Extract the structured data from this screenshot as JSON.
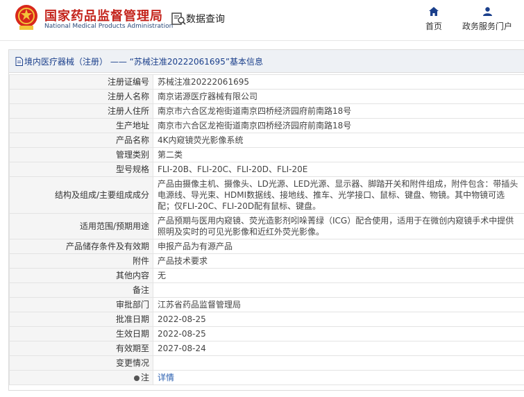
{
  "header": {
    "logo_cn": "国家药品监督管理局",
    "logo_en": "National Medical Products Administration",
    "query_label": "数据查询",
    "nav_home": "首页",
    "nav_portal": "政务服务门户",
    "brand_color": "#c4241c",
    "link_color": "#1a3f8b"
  },
  "panel": {
    "title": "境内医疗器械（注册） ——  “苏械注准20222061695”基本信息"
  },
  "rows": [
    {
      "label": "注册证编号",
      "value": "苏械注准20222061695"
    },
    {
      "label": "注册人名称",
      "value": "南京诺源医疗器械有限公司"
    },
    {
      "label": "注册人住所",
      "value": "南京市六合区龙袍街道南京四桥经济园府前南路18号"
    },
    {
      "label": "生产地址",
      "value": "南京市六合区龙袍街道南京四桥经济园府前南路18号"
    },
    {
      "label": "产品名称",
      "value": "4K内窥镜荧光影像系统"
    },
    {
      "label": "管理类别",
      "value": "第二类"
    },
    {
      "label": "型号规格",
      "value": "FLI-20B、FLI-20C、FLI-20D、FLI-20E"
    },
    {
      "label": "结构及组成/主要组成成分",
      "value": "产品由摄像主机、摄像头、LD光源、LED光源、显示器、脚踏开关和附件组成，附件包含：带插头电源线、导光束、HDMI数据线、接地线、推车、光学接口、鼠标、键盘、物镜。其中物镜可选配；仅FLI-20C、FLI-20D配有鼠标、键盘。"
    },
    {
      "label": "适用范围/预期用途",
      "value": "产品预期与医用内窥镜、荧光造影剂吲哚菁绿（ICG）配合使用，适用于在微创内窥镜手术中提供照明及实时的可见光影像和近红外荧光影像。"
    },
    {
      "label": "产品储存条件及有效期",
      "value": "申报产品为有源产品"
    },
    {
      "label": "附件",
      "value": "产品技术要求"
    },
    {
      "label": "其他内容",
      "value": "无"
    },
    {
      "label": "备注",
      "value": ""
    },
    {
      "label": "审批部门",
      "value": "江苏省药品监督管理局"
    },
    {
      "label": "批准日期",
      "value": "2022-08-25"
    },
    {
      "label": "生效日期",
      "value": "2022-08-25"
    },
    {
      "label": "有效期至",
      "value": "2027-08-24"
    },
    {
      "label": "变更情况",
      "value": ""
    }
  ],
  "note_row": {
    "label": "注",
    "link": "详情"
  }
}
